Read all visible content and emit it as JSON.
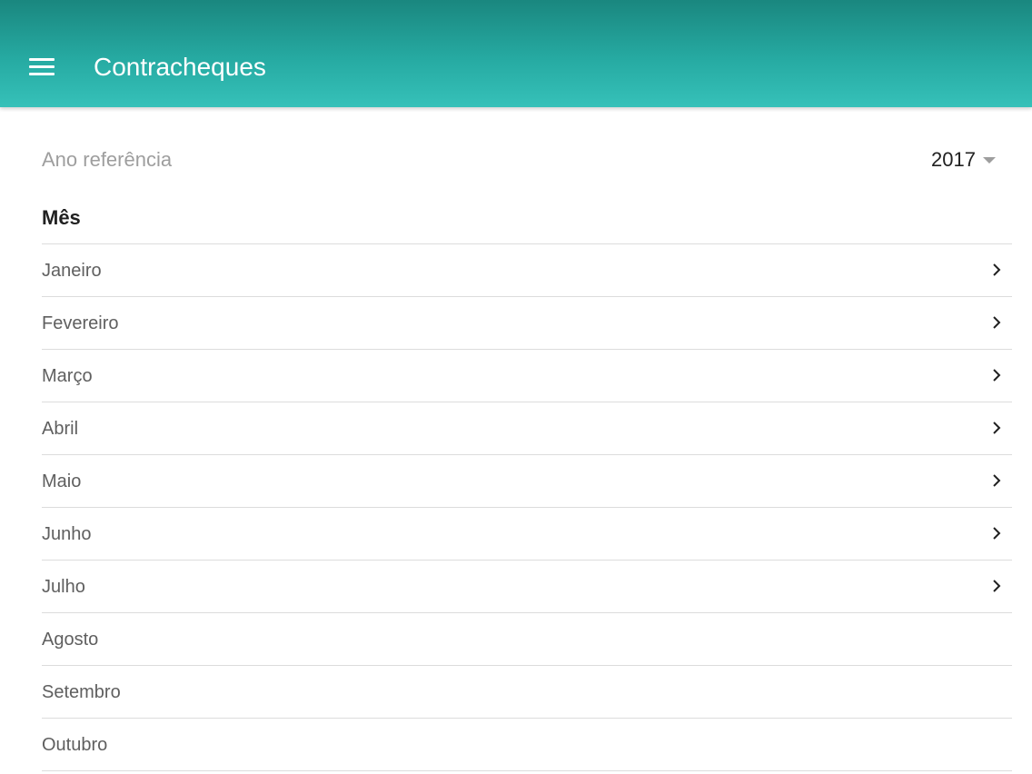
{
  "appbar": {
    "title": "Contracheques",
    "menu_icon": "hamburger-menu-icon"
  },
  "filter": {
    "year_label": "Ano referência",
    "year_value": "2017",
    "dropdown_icon": "caret-down-icon"
  },
  "section": {
    "header": "Mês"
  },
  "months": [
    {
      "label": "Janeiro",
      "has_chevron": true
    },
    {
      "label": "Fevereiro",
      "has_chevron": true
    },
    {
      "label": "Março",
      "has_chevron": true
    },
    {
      "label": "Abril",
      "has_chevron": true
    },
    {
      "label": "Maio",
      "has_chevron": true
    },
    {
      "label": "Junho",
      "has_chevron": true
    },
    {
      "label": "Julho",
      "has_chevron": true
    },
    {
      "label": "Agosto",
      "has_chevron": false
    },
    {
      "label": "Setembro",
      "has_chevron": false
    },
    {
      "label": "Outubro",
      "has_chevron": false
    }
  ],
  "colors": {
    "appbar_top": "#1a877f",
    "appbar_bottom": "#36c1b9",
    "label_gray": "#9e9e9e",
    "text_dark": "#212121",
    "divider": "#dcdcdc"
  }
}
